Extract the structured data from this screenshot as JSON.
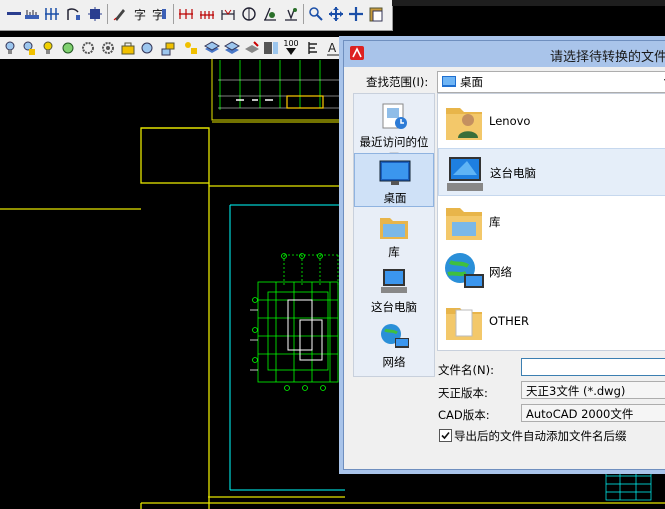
{
  "toolbar_top": {
    "icons": [
      "measure-line-icon",
      "ruler-icon",
      "column-grid-icon",
      "arc-icon",
      "hatch-icon",
      "brush-icon",
      "text-icon",
      "text-style-icon",
      "dimension-icon",
      "dimension-chain-icon",
      "dimension-angle-icon",
      "circle-icon",
      "symbol-icon",
      "section-icon",
      "link-icon",
      "move-icon",
      "pan-icon",
      "clipboard-icon"
    ]
  },
  "toolbar_second": {
    "icons": [
      "bulb-icon",
      "layer-icon",
      "light-icon",
      "sun-icon",
      "gear-icon",
      "settings-icon",
      "lock-icon",
      "layers-icon",
      "layers-stack-icon",
      "layers-off-icon",
      "elevation-icon",
      "label-icon",
      "text-a-icon"
    ],
    "elevation_text": "100"
  },
  "dialog": {
    "title": "请选择待转换的文件",
    "lookin_label": "查找范围(I):",
    "lookin_value": "桌面",
    "places": [
      {
        "label": "最近访问的位置",
        "icon": "recent-places-icon"
      },
      {
        "label": "桌面",
        "icon": "desktop-icon",
        "selected": true
      },
      {
        "label": "库",
        "icon": "library-icon"
      },
      {
        "label": "这台电脑",
        "icon": "computer-icon"
      },
      {
        "label": "网络",
        "icon": "network-icon"
      }
    ],
    "files": [
      {
        "name": "Lenovo",
        "icon": "user-folder-icon"
      },
      {
        "name": "这台电脑",
        "icon": "computer-icon",
        "selected": true
      },
      {
        "name": "库",
        "icon": "library-folder-icon"
      },
      {
        "name": "网络",
        "icon": "network-icon"
      },
      {
        "name": "OTHER",
        "icon": "folder-icon"
      }
    ],
    "filename_label": "文件名(N):",
    "filename_value": "",
    "tzversion_label": "天正版本:",
    "tzversion_value": "天正3文件 (*.dwg)",
    "cadversion_label": "CAD版本:",
    "cadversion_value": "AutoCAD 2000文件",
    "checkbox_label": "导出后的文件自动添加文件名后缀",
    "checkbox_checked": true
  },
  "colors": {
    "canvas": "#000000",
    "drawing_yellow": "#e6e600",
    "drawing_green": "#00ff00",
    "drawing_cyan": "#00ffff",
    "dialog_frame": "#a9c4ea"
  }
}
